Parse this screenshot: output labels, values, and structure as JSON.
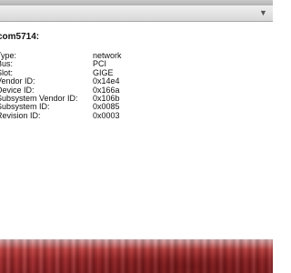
{
  "toolbar": {
    "scroll_icon": "chevron-down-icon",
    "scroll_glyph": "▼"
  },
  "device": {
    "name": "com5714:",
    "properties": [
      {
        "label": "Type:",
        "value": "network"
      },
      {
        "label": "Bus:",
        "value": "PCI"
      },
      {
        "label": "Slot:",
        "value": "GIGE"
      },
      {
        "label": "Vendor ID:",
        "value": "0x14e4"
      },
      {
        "label": "Device ID:",
        "value": "0x166a"
      },
      {
        "label": "Subsystem Vendor ID:",
        "value": "0x106b"
      },
      {
        "label": "Subsystem ID:",
        "value": "0x0085"
      },
      {
        "label": "Revision ID:",
        "value": "0x0003"
      }
    ]
  },
  "colors": {
    "toolbar": "#d8d8d8",
    "content_background": "#ffffff",
    "text": "#111111",
    "desktop": "#a3282a"
  }
}
